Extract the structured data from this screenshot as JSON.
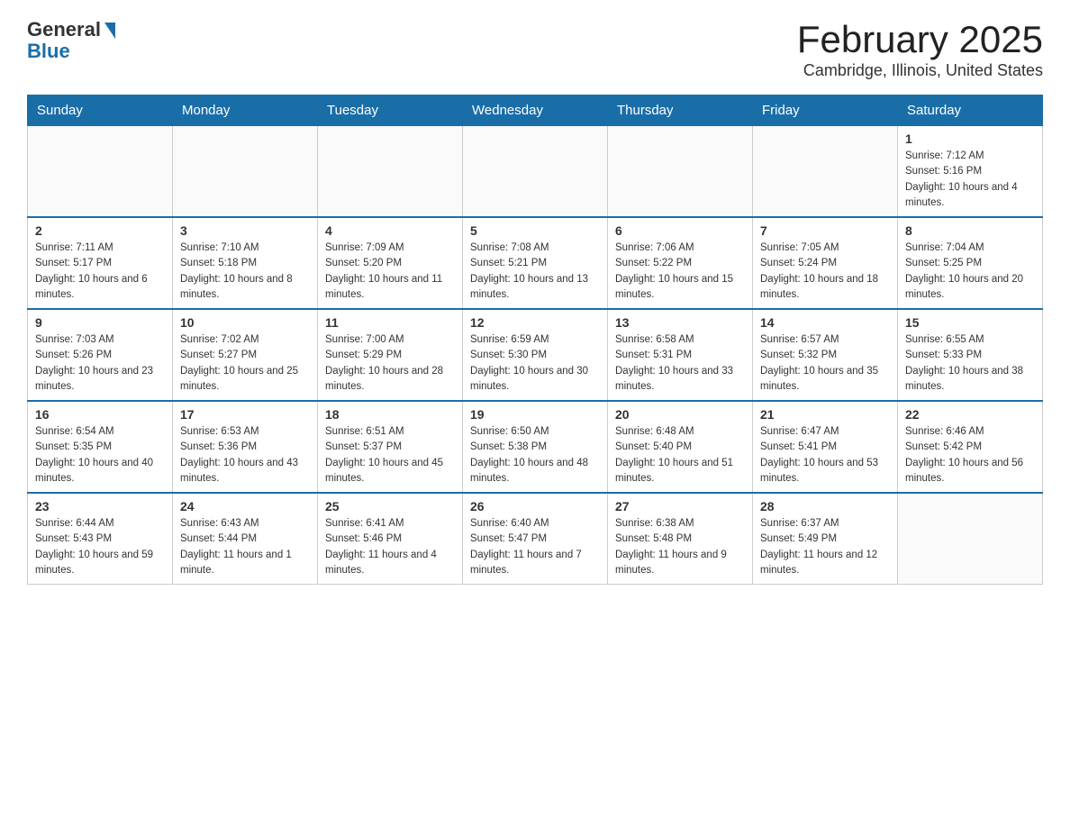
{
  "logo": {
    "general": "General",
    "blue": "Blue"
  },
  "title": "February 2025",
  "subtitle": "Cambridge, Illinois, United States",
  "days_of_week": [
    "Sunday",
    "Monday",
    "Tuesday",
    "Wednesday",
    "Thursday",
    "Friday",
    "Saturday"
  ],
  "weeks": [
    [
      {
        "day": "",
        "info": ""
      },
      {
        "day": "",
        "info": ""
      },
      {
        "day": "",
        "info": ""
      },
      {
        "day": "",
        "info": ""
      },
      {
        "day": "",
        "info": ""
      },
      {
        "day": "",
        "info": ""
      },
      {
        "day": "1",
        "info": "Sunrise: 7:12 AM\nSunset: 5:16 PM\nDaylight: 10 hours and 4 minutes."
      }
    ],
    [
      {
        "day": "2",
        "info": "Sunrise: 7:11 AM\nSunset: 5:17 PM\nDaylight: 10 hours and 6 minutes."
      },
      {
        "day": "3",
        "info": "Sunrise: 7:10 AM\nSunset: 5:18 PM\nDaylight: 10 hours and 8 minutes."
      },
      {
        "day": "4",
        "info": "Sunrise: 7:09 AM\nSunset: 5:20 PM\nDaylight: 10 hours and 11 minutes."
      },
      {
        "day": "5",
        "info": "Sunrise: 7:08 AM\nSunset: 5:21 PM\nDaylight: 10 hours and 13 minutes."
      },
      {
        "day": "6",
        "info": "Sunrise: 7:06 AM\nSunset: 5:22 PM\nDaylight: 10 hours and 15 minutes."
      },
      {
        "day": "7",
        "info": "Sunrise: 7:05 AM\nSunset: 5:24 PM\nDaylight: 10 hours and 18 minutes."
      },
      {
        "day": "8",
        "info": "Sunrise: 7:04 AM\nSunset: 5:25 PM\nDaylight: 10 hours and 20 minutes."
      }
    ],
    [
      {
        "day": "9",
        "info": "Sunrise: 7:03 AM\nSunset: 5:26 PM\nDaylight: 10 hours and 23 minutes."
      },
      {
        "day": "10",
        "info": "Sunrise: 7:02 AM\nSunset: 5:27 PM\nDaylight: 10 hours and 25 minutes."
      },
      {
        "day": "11",
        "info": "Sunrise: 7:00 AM\nSunset: 5:29 PM\nDaylight: 10 hours and 28 minutes."
      },
      {
        "day": "12",
        "info": "Sunrise: 6:59 AM\nSunset: 5:30 PM\nDaylight: 10 hours and 30 minutes."
      },
      {
        "day": "13",
        "info": "Sunrise: 6:58 AM\nSunset: 5:31 PM\nDaylight: 10 hours and 33 minutes."
      },
      {
        "day": "14",
        "info": "Sunrise: 6:57 AM\nSunset: 5:32 PM\nDaylight: 10 hours and 35 minutes."
      },
      {
        "day": "15",
        "info": "Sunrise: 6:55 AM\nSunset: 5:33 PM\nDaylight: 10 hours and 38 minutes."
      }
    ],
    [
      {
        "day": "16",
        "info": "Sunrise: 6:54 AM\nSunset: 5:35 PM\nDaylight: 10 hours and 40 minutes."
      },
      {
        "day": "17",
        "info": "Sunrise: 6:53 AM\nSunset: 5:36 PM\nDaylight: 10 hours and 43 minutes."
      },
      {
        "day": "18",
        "info": "Sunrise: 6:51 AM\nSunset: 5:37 PM\nDaylight: 10 hours and 45 minutes."
      },
      {
        "day": "19",
        "info": "Sunrise: 6:50 AM\nSunset: 5:38 PM\nDaylight: 10 hours and 48 minutes."
      },
      {
        "day": "20",
        "info": "Sunrise: 6:48 AM\nSunset: 5:40 PM\nDaylight: 10 hours and 51 minutes."
      },
      {
        "day": "21",
        "info": "Sunrise: 6:47 AM\nSunset: 5:41 PM\nDaylight: 10 hours and 53 minutes."
      },
      {
        "day": "22",
        "info": "Sunrise: 6:46 AM\nSunset: 5:42 PM\nDaylight: 10 hours and 56 minutes."
      }
    ],
    [
      {
        "day": "23",
        "info": "Sunrise: 6:44 AM\nSunset: 5:43 PM\nDaylight: 10 hours and 59 minutes."
      },
      {
        "day": "24",
        "info": "Sunrise: 6:43 AM\nSunset: 5:44 PM\nDaylight: 11 hours and 1 minute."
      },
      {
        "day": "25",
        "info": "Sunrise: 6:41 AM\nSunset: 5:46 PM\nDaylight: 11 hours and 4 minutes."
      },
      {
        "day": "26",
        "info": "Sunrise: 6:40 AM\nSunset: 5:47 PM\nDaylight: 11 hours and 7 minutes."
      },
      {
        "day": "27",
        "info": "Sunrise: 6:38 AM\nSunset: 5:48 PM\nDaylight: 11 hours and 9 minutes."
      },
      {
        "day": "28",
        "info": "Sunrise: 6:37 AM\nSunset: 5:49 PM\nDaylight: 11 hours and 12 minutes."
      },
      {
        "day": "",
        "info": ""
      }
    ]
  ]
}
